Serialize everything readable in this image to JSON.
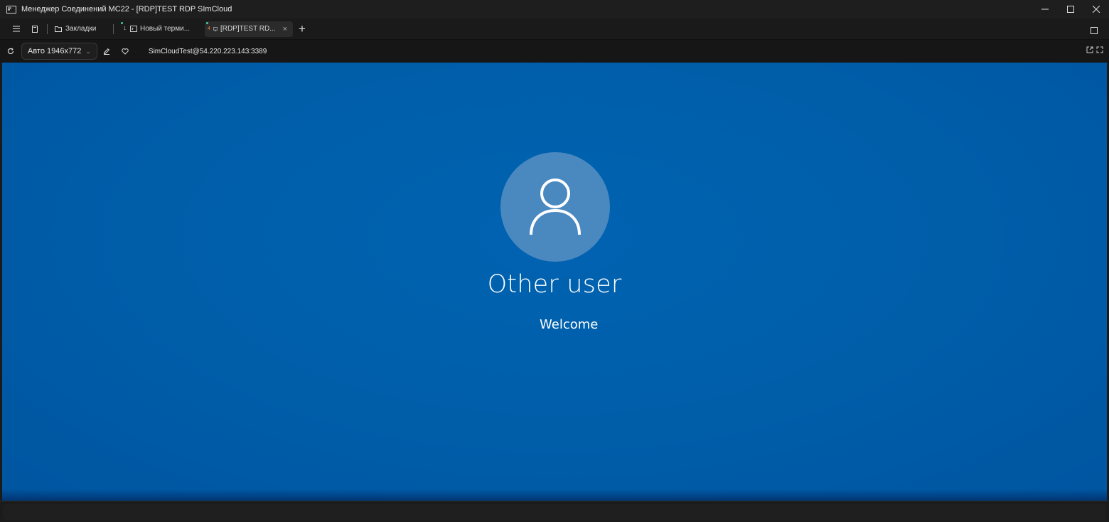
{
  "window": {
    "title": "Менеджер Соединений MC22 - [RDP]TEST RDP SImCloud",
    "controls": [
      "minimize-icon",
      "maximize-icon",
      "close-icon"
    ]
  },
  "tabbar": {
    "bookmarks_label": "Закладки",
    "tabs": [
      {
        "number": "1",
        "label": "Новый терми...",
        "icon": "terminal-icon",
        "active": false
      },
      {
        "number": "4",
        "label": "[RDP]TEST RD...",
        "icon": "monitor-icon",
        "active": true,
        "close": "×"
      }
    ],
    "add_label": "+"
  },
  "toolbar": {
    "resolution": "Авто 1946x772",
    "connection": "SimCloudTest@54.220.223.143:3389"
  },
  "remote": {
    "user_name": "Other user",
    "status": "Welcome"
  },
  "colors": {
    "remote_bg": "#0063b1",
    "avatar_bg": "#4a88c0",
    "tab_dot": "#3fd0b0"
  }
}
